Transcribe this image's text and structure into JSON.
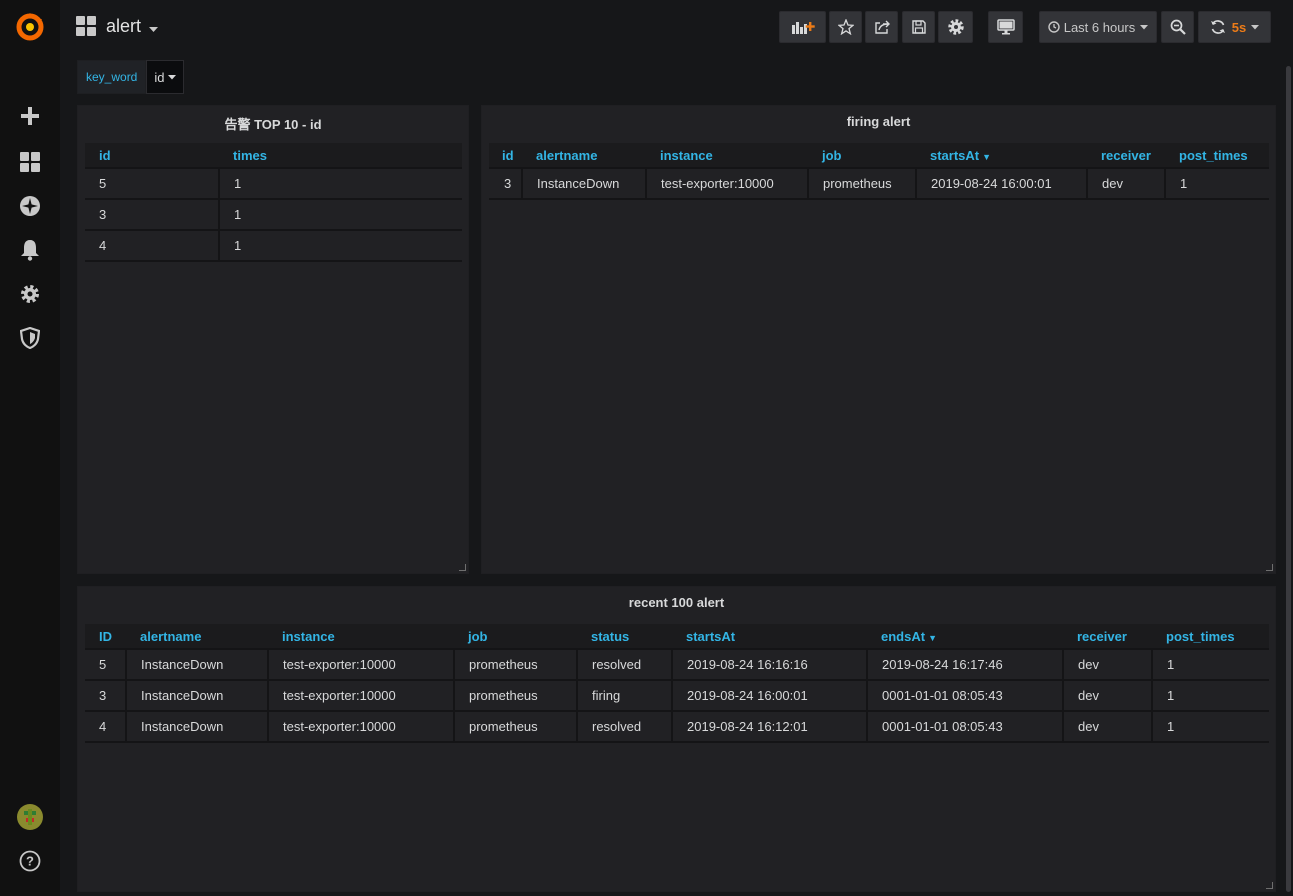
{
  "dashboard": {
    "title": "alert"
  },
  "timepicker": {
    "label": "Last 6 hours"
  },
  "refresh": {
    "label": "5s"
  },
  "variables": {
    "label": "key_word",
    "value": "id"
  },
  "panels": {
    "top10": {
      "title": "告警 TOP 10 - id",
      "columns": [
        "id",
        "times"
      ],
      "rows": [
        [
          "5",
          "1"
        ],
        [
          "3",
          "1"
        ],
        [
          "4",
          "1"
        ]
      ]
    },
    "firing": {
      "title": "firing alert",
      "columns": [
        "id",
        "alertname",
        "instance",
        "job",
        "startsAt",
        "receiver",
        "post_times"
      ],
      "rows": [
        [
          "3",
          "InstanceDown",
          "test-exporter:10000",
          "prometheus",
          "2019-08-24 16:00:01",
          "dev",
          "1"
        ]
      ]
    },
    "recent": {
      "title": "recent 100 alert",
      "columns": [
        "ID",
        "alertname",
        "instance",
        "job",
        "status",
        "startsAt",
        "endsAt",
        "receiver",
        "post_times"
      ],
      "rows": [
        [
          "5",
          "InstanceDown",
          "test-exporter:10000",
          "prometheus",
          "resolved",
          "2019-08-24 16:16:16",
          "2019-08-24 16:17:46",
          "dev",
          "1"
        ],
        [
          "3",
          "InstanceDown",
          "test-exporter:10000",
          "prometheus",
          "firing",
          "2019-08-24 16:00:01",
          "0001-01-01 08:05:43",
          "dev",
          "1"
        ],
        [
          "4",
          "InstanceDown",
          "test-exporter:10000",
          "prometheus",
          "resolved",
          "2019-08-24 16:12:01",
          "0001-01-01 08:05:43",
          "dev",
          "1"
        ]
      ]
    }
  },
  "colors": {
    "accent": "#33b5e5",
    "refresh": "#eb7b18",
    "logo": "#f46800"
  },
  "icons": {
    "logo": "grafana-logo",
    "sidebar": [
      "plus-icon",
      "dashboards-icon",
      "compass-icon",
      "bell-icon",
      "gear-icon",
      "shield-icon",
      "avatar",
      "help-icon"
    ]
  }
}
